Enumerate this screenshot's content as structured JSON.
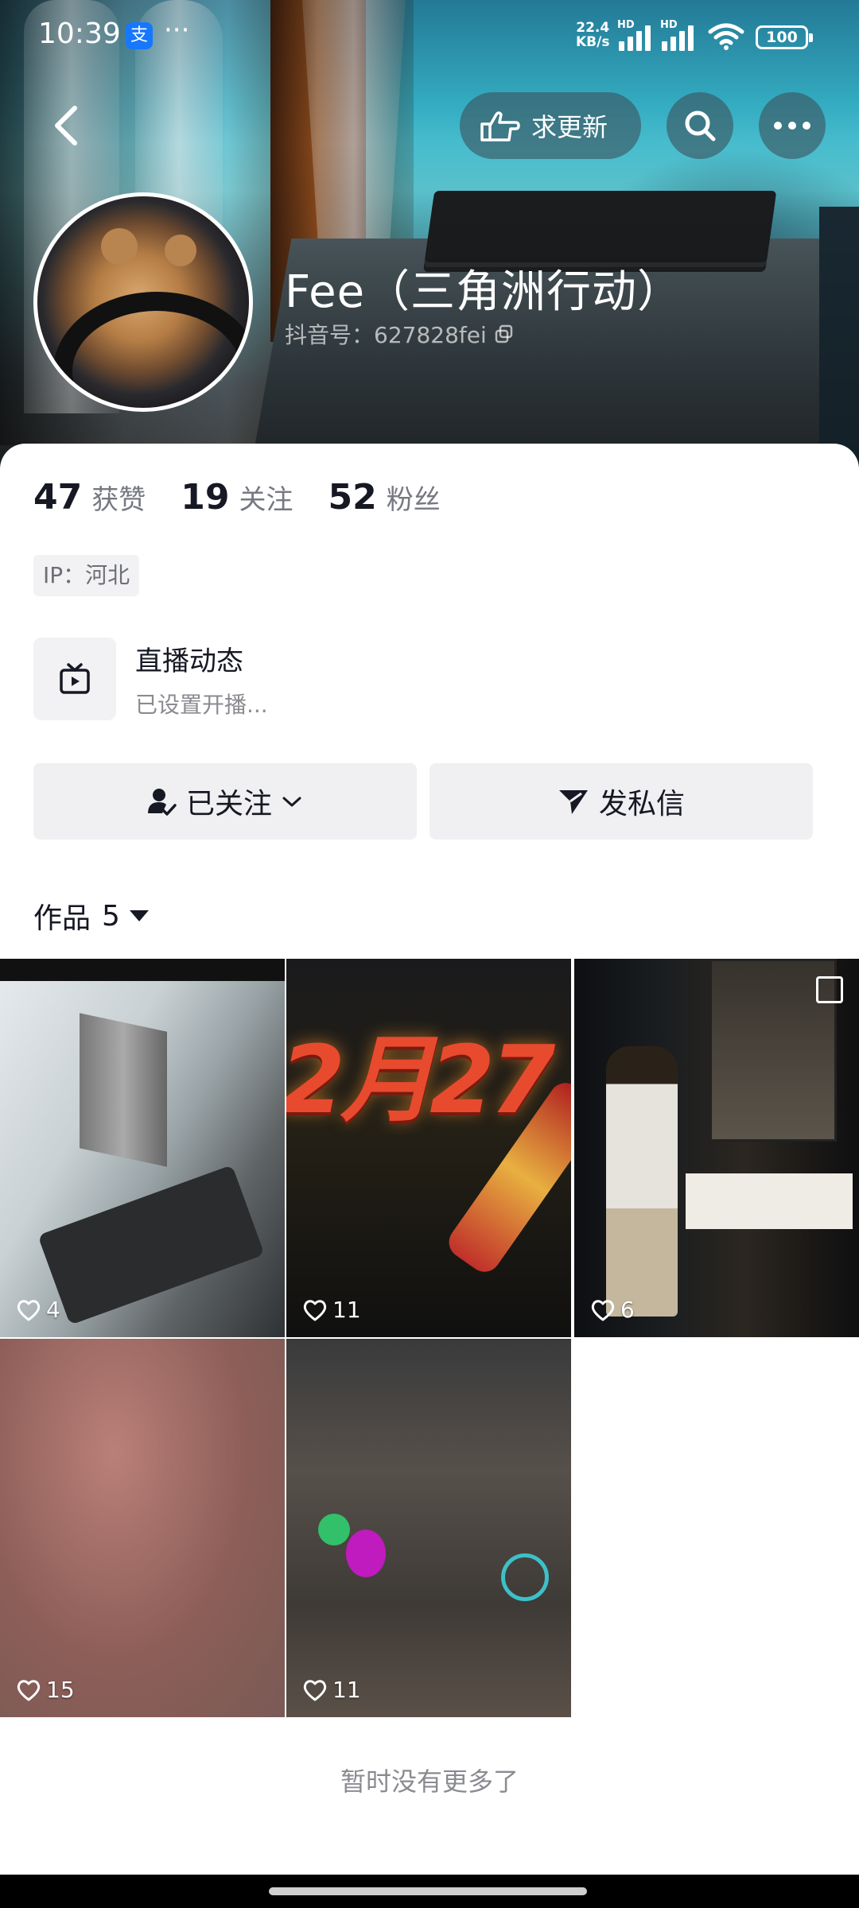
{
  "status_bar": {
    "time": "10:39",
    "alipay_glyph": "支",
    "more_dots": "···",
    "net_speed_value": "22.4",
    "net_speed_unit": "KB/s",
    "hd1": "HD",
    "hd2": "HD",
    "battery": "100"
  },
  "nav": {
    "request_update_label": "求更新"
  },
  "profile": {
    "name": "Fee（三角洲行动）",
    "douyin_id": "抖音号：627828fei"
  },
  "stats": [
    {
      "value": "47",
      "label": "获赞"
    },
    {
      "value": "19",
      "label": "关注"
    },
    {
      "value": "52",
      "label": "粉丝"
    }
  ],
  "ip_tag": "IP：河北",
  "live": {
    "title": "直播动态",
    "subtitle": "已设置开播..."
  },
  "actions": {
    "follow_label": "已关注",
    "message_label": "发私信"
  },
  "works": {
    "label": "作品",
    "count": "5"
  },
  "grid": [
    {
      "likes": "4"
    },
    {
      "likes": "11",
      "overlay_text": "2月27"
    },
    {
      "likes": "6"
    },
    {
      "likes": "15"
    },
    {
      "likes": "11"
    }
  ],
  "footer": {
    "no_more": "暂时没有更多了"
  },
  "colors": {
    "primary_text": "#161823",
    "secondary_text": "#767981",
    "button_bg": "#f0f0f2",
    "alipay_blue": "#1677ff"
  }
}
